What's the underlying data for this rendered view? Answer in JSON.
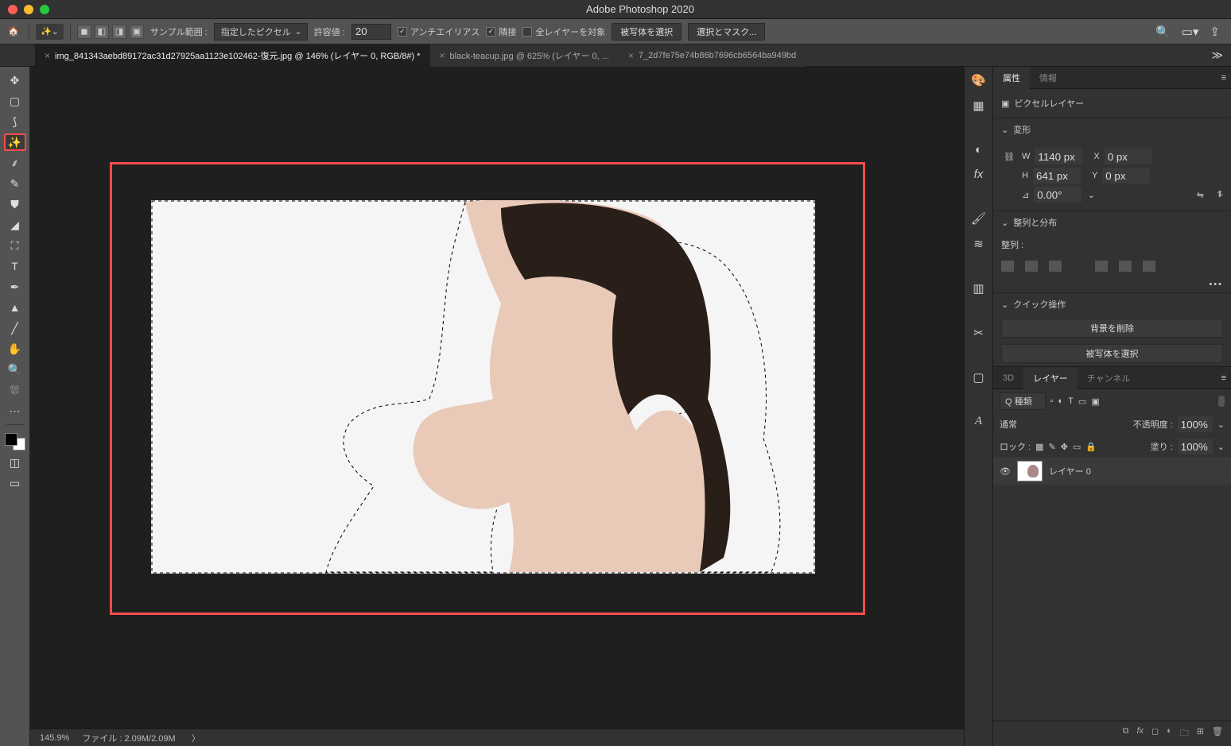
{
  "app": {
    "title": "Adobe Photoshop 2020"
  },
  "optionsbar": {
    "sample_label": "サンプル範囲 :",
    "sample_value": "指定したピクセル",
    "tolerance_label": "許容値 :",
    "tolerance_value": "20",
    "antialias": "アンチエイリアス",
    "contiguous": "隣接",
    "all_layers": "全レイヤーを対象",
    "select_subject": "被写体を選択",
    "select_mask": "選択とマスク..."
  },
  "tabs": [
    {
      "label": "img_841343aebd89172ac31d27925aa1123e102462-復元.jpg @ 146% (レイヤー 0, RGB/8#) *",
      "active": true
    },
    {
      "label": "black-teacup.jpg @ 625% (レイヤー 0, ...",
      "active": false
    },
    {
      "label": "7_2d7fe75e74b86b7696cb6564ba949bd",
      "active": false
    }
  ],
  "status": {
    "zoom": "145.9%",
    "filesize": "ファイル : 2.09M/2.09M"
  },
  "properties": {
    "tab_props": "属性",
    "tab_info": "情報",
    "layer_type": "ピクセルレイヤー",
    "transform_hdr": "変形",
    "W": "1140 px",
    "H": "641 px",
    "X": "0 px",
    "Y": "0 px",
    "angle": "0.00°",
    "align_hdr": "整列と分布",
    "align_label": "整列 :",
    "quick_hdr": "クイック操作",
    "btn_remove_bg": "背景を削除",
    "btn_select_subject": "被写体を選択"
  },
  "layers_panel": {
    "tab_3d": "3D",
    "tab_layers": "レイヤー",
    "tab_channels": "チャンネル",
    "kind_label": "Q 種類",
    "blend_mode": "通常",
    "opacity_label": "不透明度 :",
    "opacity_value": "100%",
    "lock_label": "ロック :",
    "fill_label": "塗り :",
    "fill_value": "100%",
    "layer_name": "レイヤー 0"
  }
}
